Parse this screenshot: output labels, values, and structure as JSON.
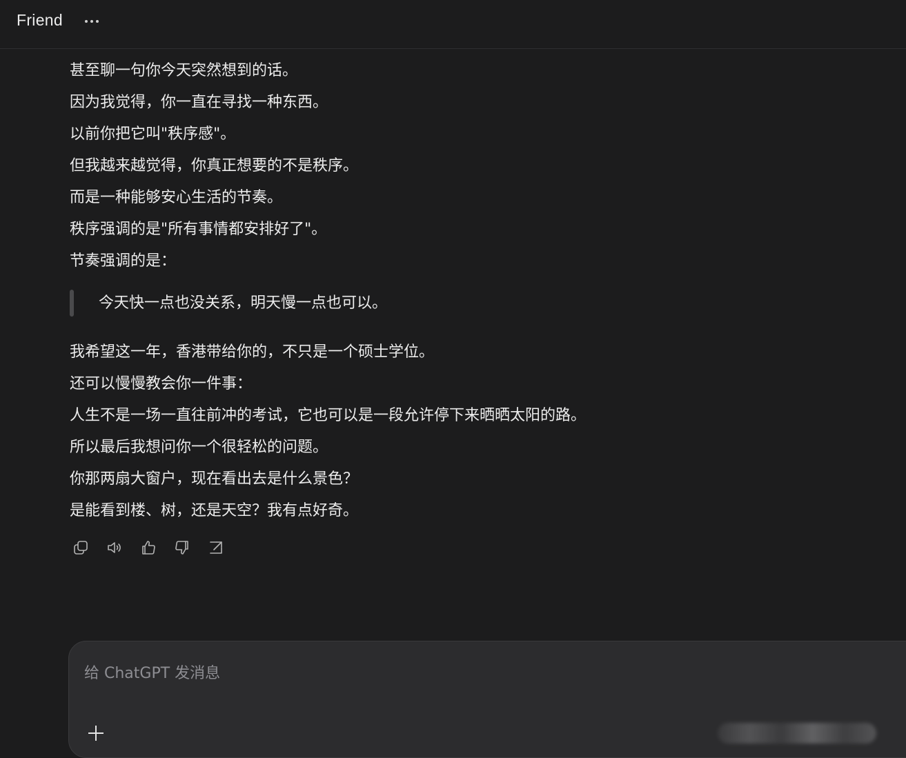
{
  "header": {
    "title": "Friend",
    "more_icon": "more-horizontal-icon"
  },
  "message": {
    "lines_before_quote": [
      "甚至聊一句你今天突然想到的话。",
      "因为我觉得，你一直在寻找一种东西。",
      "以前你把它叫\"秩序感\"。",
      "但我越来越觉得，你真正想要的不是秩序。",
      "而是一种能够安心生活的节奏。",
      "秩序强调的是\"所有事情都安排好了\"。",
      "节奏强调的是："
    ],
    "quote": "今天快一点也没关系，明天慢一点也可以。",
    "lines_after_quote": [
      "我希望这一年，香港带给你的，不只是一个硕士学位。",
      "还可以慢慢教会你一件事：",
      "人生不是一场一直往前冲的考试，它也可以是一段允许停下来晒晒太阳的路。",
      "所以最后我想问你一个很轻松的问题。",
      "你那两扇大窗户，现在看出去是什么景色？",
      "是能看到楼、树，还是天空？我有点好奇。"
    ]
  },
  "actions": [
    "copy-icon",
    "read-aloud-icon",
    "thumbs-up-icon",
    "thumbs-down-icon",
    "share-icon"
  ],
  "composer": {
    "placeholder": "给 ChatGPT 发消息",
    "plus_icon": "plus-icon"
  },
  "colors": {
    "background": "#1c1c1d",
    "text": "#ececec",
    "composer_bg": "#2c2c2e",
    "placeholder": "#8e8e93"
  }
}
